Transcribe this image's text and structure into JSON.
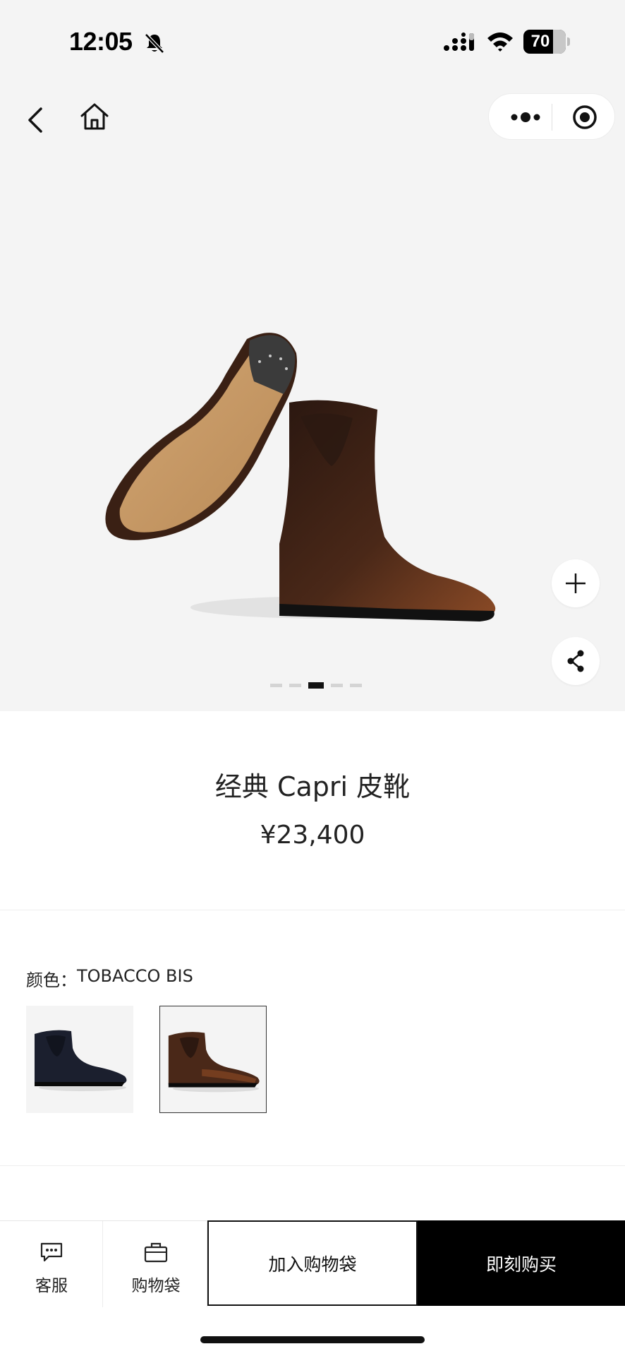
{
  "status_bar": {
    "time": "12:05",
    "battery": "70"
  },
  "nav": {
    "back_icon": "chevron-left-icon",
    "home_icon": "home-icon",
    "more_icon": "more-dots-icon",
    "close_icon": "target-circle-icon"
  },
  "gallery": {
    "image_count": 5,
    "active_index": 2,
    "zoom_icon": "plus-icon",
    "share_icon": "share-icon"
  },
  "product": {
    "title": "经典 Capri 皮靴",
    "price": "¥23,400",
    "color_label": "颜色：",
    "color_value": "TOBACCO BIS",
    "swatches": [
      "navy",
      "tobacco"
    ]
  },
  "bottom_bar": {
    "service_label": "客服",
    "bag_label": "购物袋",
    "add_to_bag": "加入购物袋",
    "buy_now": "即刻购买"
  },
  "colors": {
    "gallery_bg": "#f4f4f4",
    "accent": "#000000",
    "leather_brown": "#5a3220",
    "sole_tan": "#c99a66"
  }
}
